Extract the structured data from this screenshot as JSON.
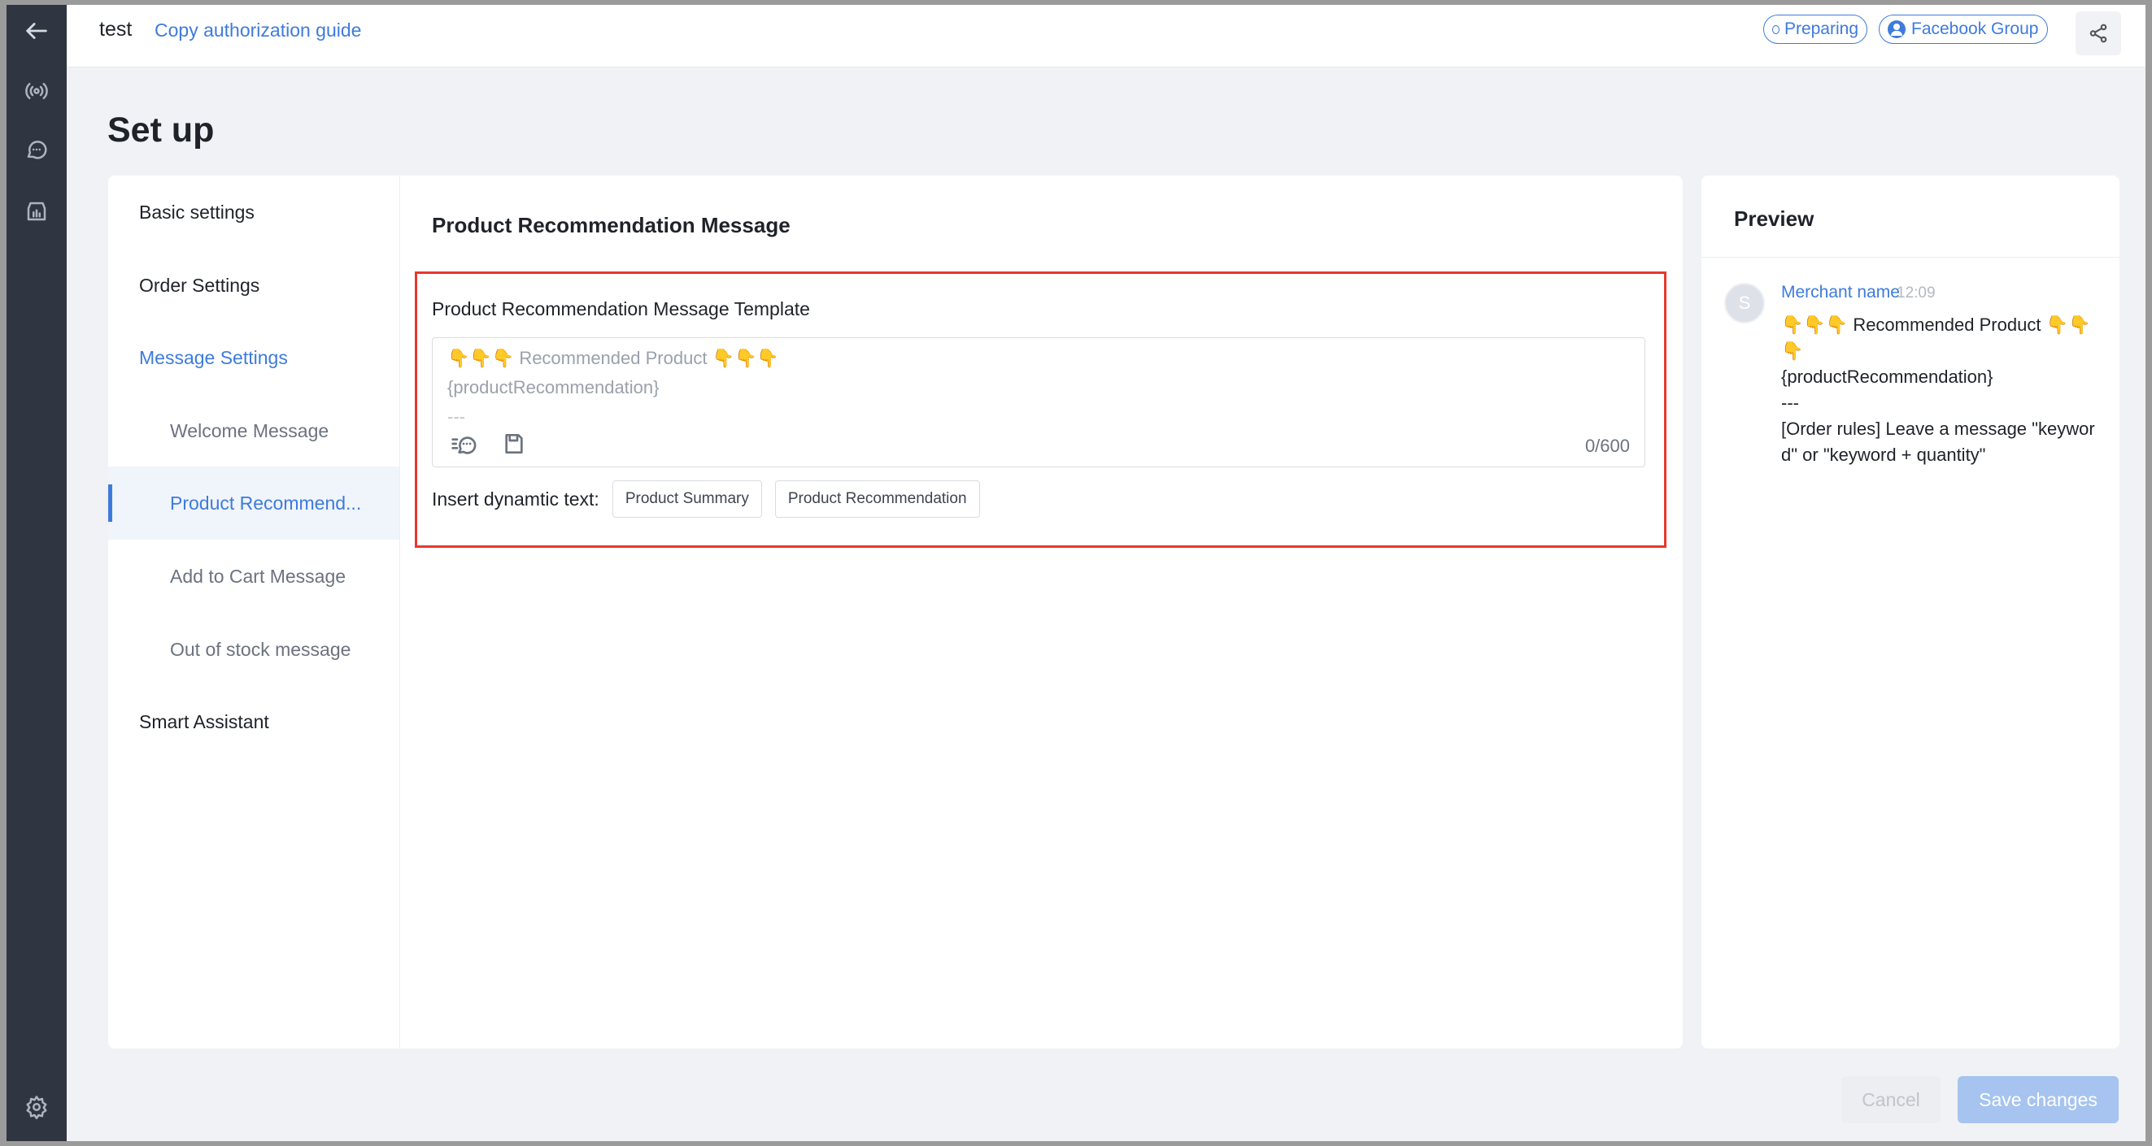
{
  "header": {
    "app_name": "test",
    "guide_link": "Copy authorization guide",
    "status_badge": "Preparing",
    "group_badge": "Facebook Group"
  },
  "page_title": "Set up",
  "sidebar_icons": [
    "back-arrow-icon",
    "broadcast-icon",
    "chat-icon",
    "store-chart-icon",
    "gear-icon"
  ],
  "settings_nav": {
    "items": [
      {
        "label": "Basic settings"
      },
      {
        "label": "Order Settings"
      },
      {
        "label": "Message Settings"
      },
      {
        "label": "Welcome Message"
      },
      {
        "label": "Product Recommend..."
      },
      {
        "label": "Add to Cart Message"
      },
      {
        "label": "Out of stock message"
      },
      {
        "label": "Smart Assistant"
      }
    ]
  },
  "main": {
    "section_title": "Product Recommendation Message",
    "field_label": "Product Recommendation Message Template",
    "editor": {
      "line1_emoji_left": "👇👇👇",
      "line1_text": "Recommended Product",
      "line1_emoji_right": "👇👇👇",
      "line2": "{productRecommendation}",
      "line3": "---",
      "counter": "0/600"
    },
    "insert_label": "Insert dynamtic text:",
    "chips": [
      "Product Summary",
      "Product Recommendation"
    ]
  },
  "preview": {
    "title": "Preview",
    "avatar_letter": "S",
    "sender": "Merchant name",
    "time": "12:09",
    "line1_emoji_left": "👇👇👇",
    "line1_text": "Recommended Product",
    "line1_emoji_right": "👇👇👇",
    "line2": "{productRecommendation}",
    "line3": "---",
    "line4": "[Order rules] Leave a message \"keyword\" or \"keyword + quantity\""
  },
  "footer": {
    "cancel": "Cancel",
    "save": "Save changes"
  },
  "colors": {
    "accent": "#3e7bdc",
    "highlight": "#e8372c",
    "rail": "#2f3541"
  }
}
